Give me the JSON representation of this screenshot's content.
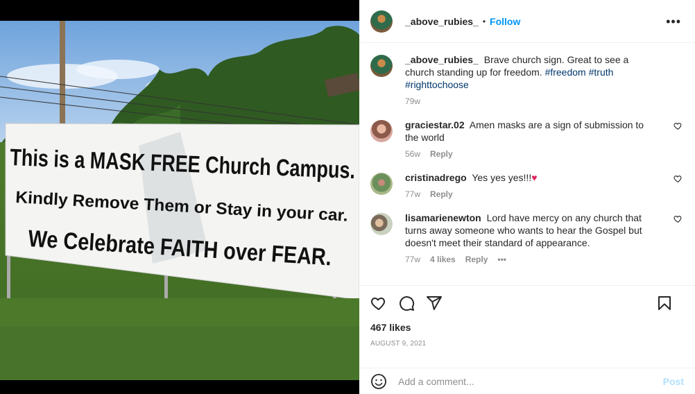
{
  "post": {
    "username": "_above_rubies_",
    "separator": "•",
    "follow_label": "Follow",
    "more_label": "•••",
    "photo_alt": "",
    "banner": {
      "line1": "This is a MASK FREE Church Campus.",
      "line2": "Kindly Remove Them or Stay in your car.",
      "line3": "We Celebrate FAITH over FEAR."
    }
  },
  "caption": {
    "username": "_above_rubies_",
    "text": "Brave church sign. Great to see a church standing up for freedom.",
    "tags": [
      "#freedom",
      "#truth",
      "#righttochoose"
    ],
    "time": "79w"
  },
  "comments": [
    {
      "username": "graciestar.02",
      "text": "Amen masks are a sign of submission to the world",
      "time": "56w",
      "likes": "",
      "reply_label": "Reply"
    },
    {
      "username": "cristinadrego",
      "text": "Yes yes yes!!!",
      "emoji": "♥",
      "time": "77w",
      "likes": "",
      "reply_label": "Reply"
    },
    {
      "username": "lisamarienewton",
      "text": "Lord have mercy on any church that turns away someone who wants to hear the Gospel but doesn't meet their standard of appearance.",
      "time": "77w",
      "likes": "4 likes",
      "reply_label": "Reply",
      "more_label": "•••"
    }
  ],
  "actions": {
    "icons": [
      "heart-icon",
      "comment-icon",
      "share-icon",
      "bookmark-icon"
    ],
    "likes": "467 likes",
    "date": "AUGUST 9, 2021"
  },
  "add_comment": {
    "placeholder": "Add a comment...",
    "post_label": "Post"
  },
  "colors": {
    "link_blue": "#0095f6",
    "hashtag": "#00376b",
    "muted": "#8e8e8e",
    "post_disabled": "#b2dffc"
  }
}
